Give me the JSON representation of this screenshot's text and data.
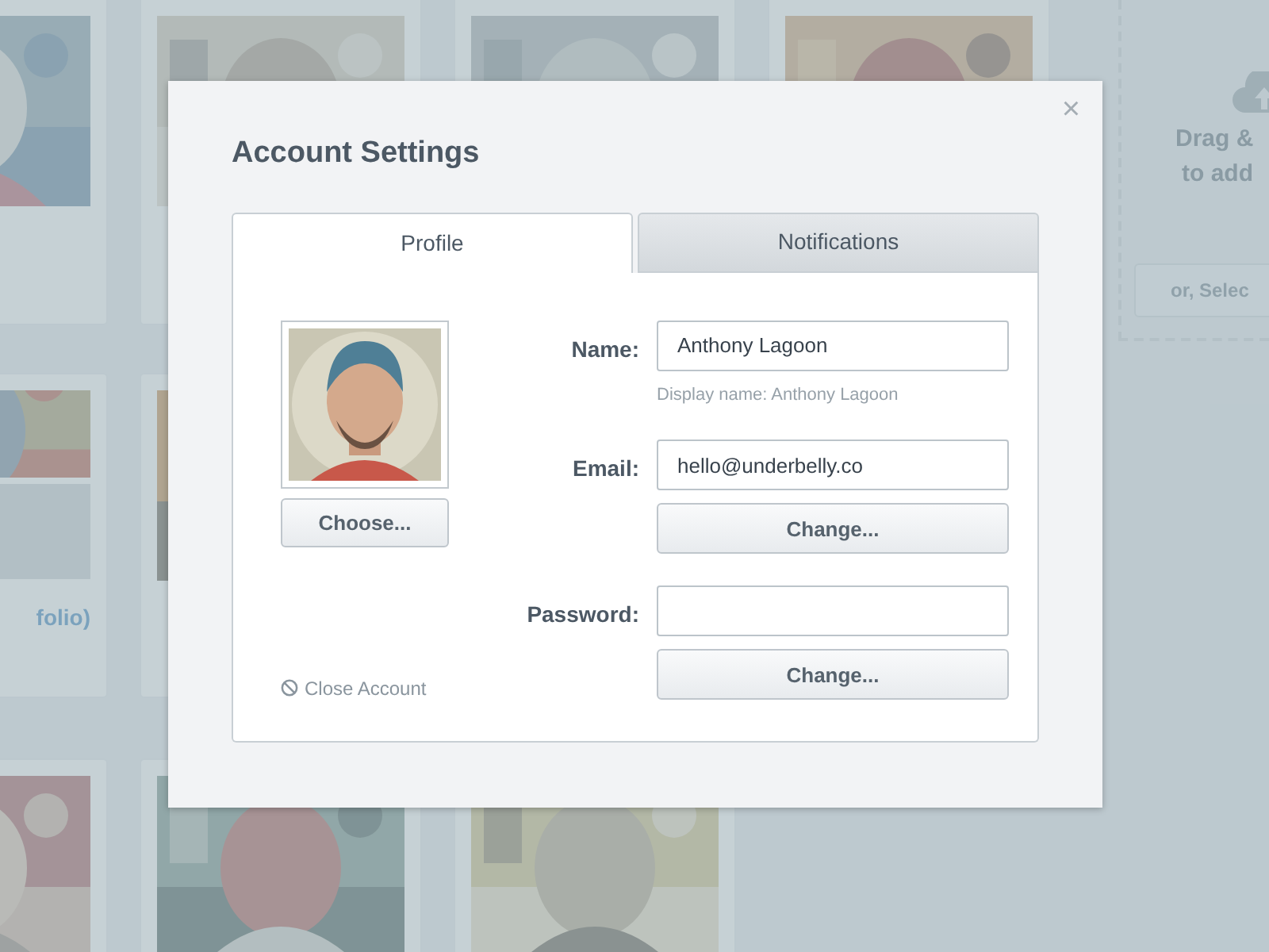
{
  "background": {
    "gallery": [
      [
        {
          "kind": "picture"
        },
        {
          "kind": "picture"
        },
        {
          "kind": "picture"
        },
        {
          "kind": "picture"
        }
      ],
      [
        {
          "kind": "picture",
          "loading": true,
          "caption": "folio)"
        },
        {
          "kind": "picture"
        }
      ],
      [
        {
          "kind": "picture"
        },
        {
          "kind": "picture"
        },
        {
          "kind": "picture"
        }
      ]
    ],
    "upload": {
      "prompt_lines": [
        "Drag &",
        "to add"
      ],
      "button": "or, Selec"
    }
  },
  "dialog": {
    "title": "Account Settings",
    "close": "×",
    "tabs": [
      {
        "label": "Profile",
        "selected": true
      },
      {
        "label": "Notifications",
        "selected": false
      }
    ],
    "profile": {
      "avatar": {
        "kind": "picture"
      },
      "choose_button": "Choose...",
      "fields": [
        {
          "label": "Name:",
          "value": "Anthony Lagoon",
          "hint": "Display name: Anthony Lagoon"
        },
        {
          "label": "Email:",
          "value": "hello@underbelly.co",
          "button": "Change..."
        },
        {
          "label": "Password:",
          "button": "Change..."
        }
      ],
      "close_account": "Close Account"
    }
  }
}
